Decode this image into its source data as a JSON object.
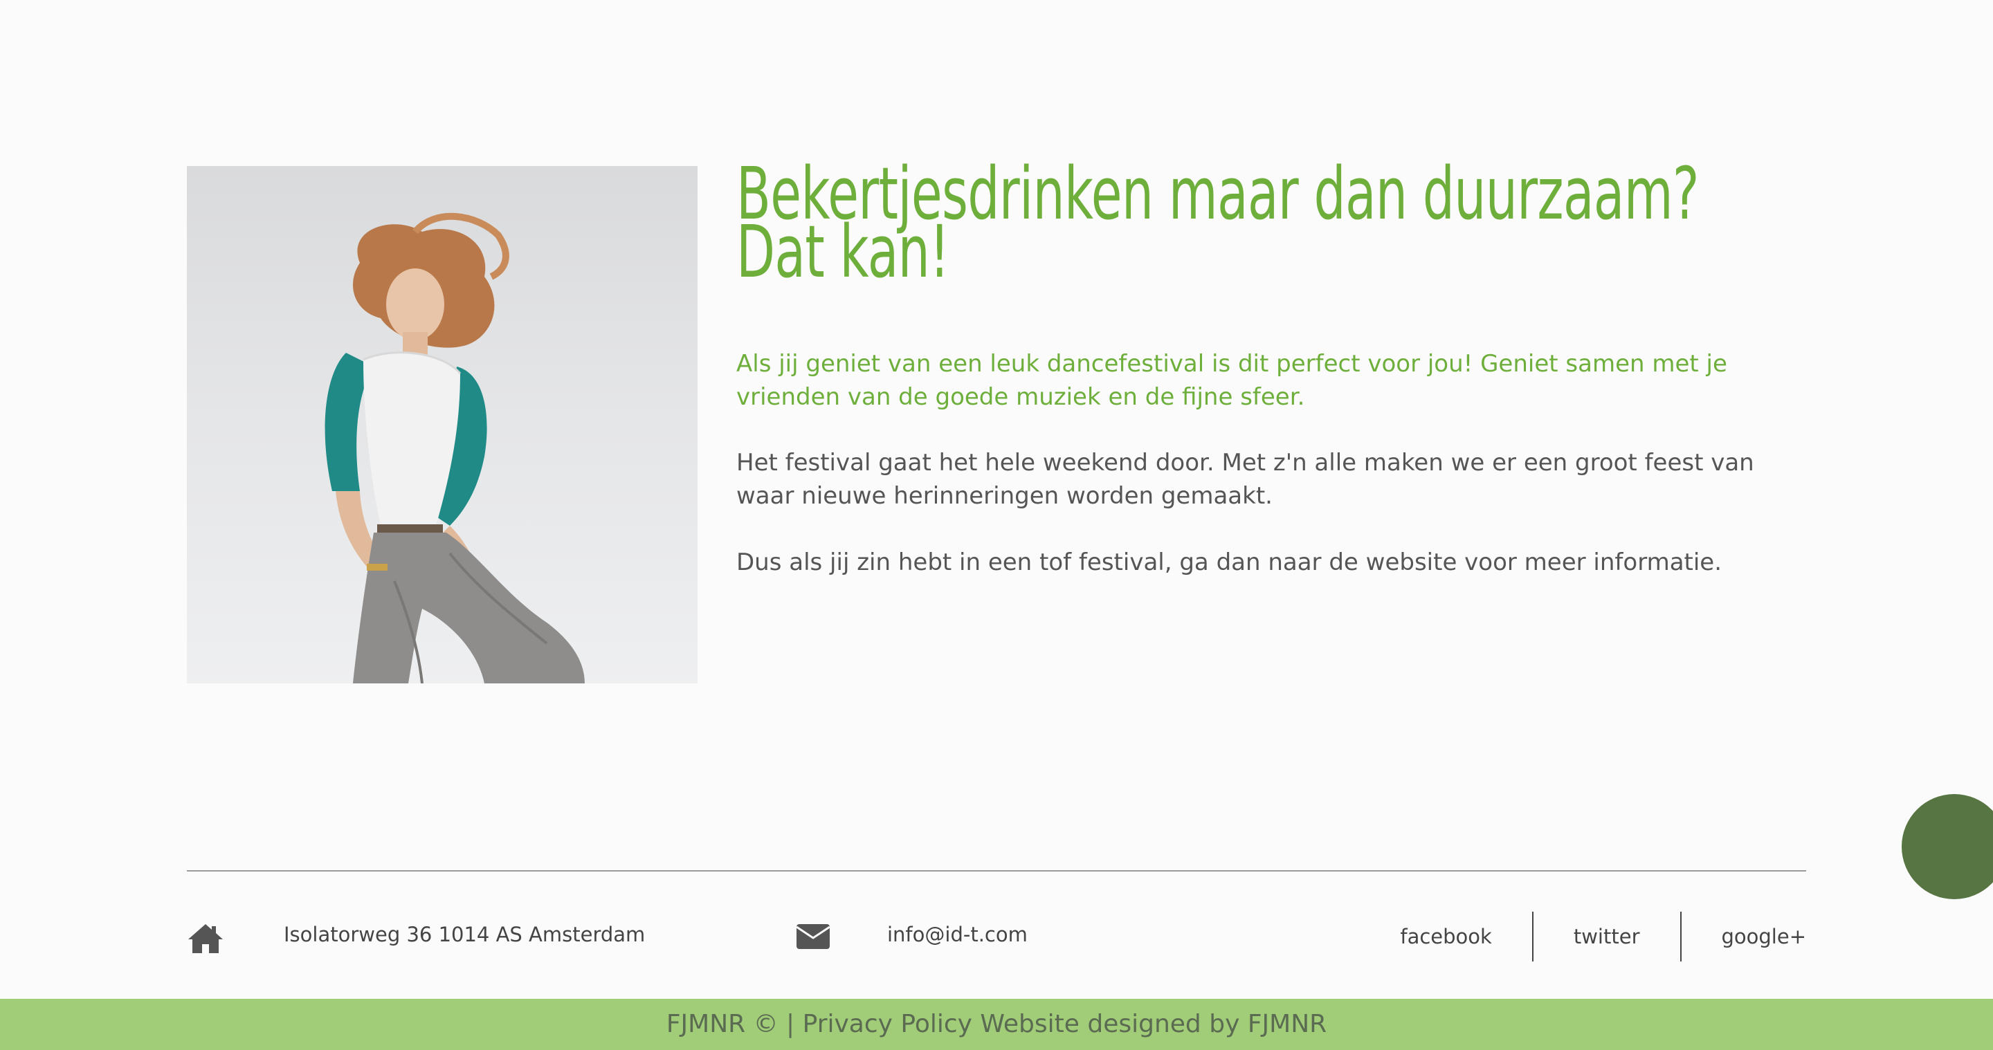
{
  "hero": {
    "headline_line1": "Bekertjesdrinken maar dan duurzaam?",
    "headline_line2": "Dat kan!",
    "intro": "Als jij geniet van een leuk dancefestival is dit perfect voor jou! Geniet samen met je vrienden van de goede muziek en de fijne sfeer.",
    "paragraph2": "Het festival gaat het hele weekend door. Met z'n alle maken we er een groot feest van waar nieuwe herinneringen worden gemaakt.",
    "paragraph3": "Dus als jij zin hebt in een tof festival, ga dan naar de website voor meer informatie."
  },
  "footer": {
    "address_icon": "home-icon",
    "address": "Isolatorweg 36 1014 AS Amsterdam",
    "email_icon": "envelope-icon",
    "email": "info@id-t.com",
    "social": [
      "facebook",
      "twitter",
      "google+"
    ]
  },
  "bottom_bar": {
    "credits": "FJMNR © | Privacy Policy Website designed by FJMNR"
  },
  "colors": {
    "accent_green": "#6eaf3c",
    "bar_green": "#a1cd79",
    "circle_green": "#577542",
    "text_gray": "#555555"
  }
}
